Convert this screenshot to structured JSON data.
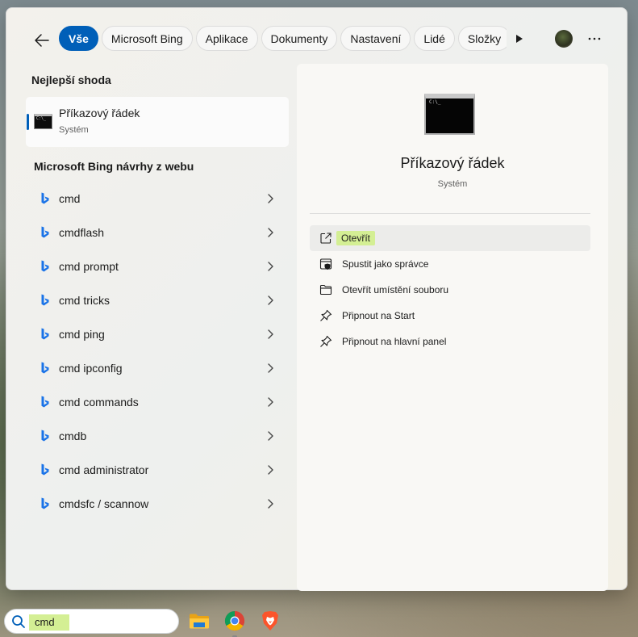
{
  "tabs": [
    {
      "label": "Vše",
      "active": true
    },
    {
      "label": "Microsoft Bing",
      "active": false
    },
    {
      "label": "Aplikace",
      "active": false
    },
    {
      "label": "Dokumenty",
      "active": false
    },
    {
      "label": "Nastavení",
      "active": false
    },
    {
      "label": "Lidé",
      "active": false
    },
    {
      "label": "Složky",
      "active": false
    }
  ],
  "left": {
    "best_match_heading": "Nejlepší shoda",
    "best_match": {
      "title": "Příkazový řádek",
      "subtitle": "Systém",
      "icon": "command-prompt-icon"
    },
    "web_heading": "Microsoft Bing návrhy z webu",
    "suggestions": [
      "cmd",
      "cmdflash",
      "cmd prompt",
      "cmd tricks",
      "cmd ping",
      "cmd ipconfig",
      "cmd commands",
      "cmdb",
      "cmd administrator",
      "cmdsfc / scannow"
    ]
  },
  "detail": {
    "title": "Příkazový řádek",
    "subtitle": "Systém",
    "actions": [
      {
        "label": "Otevřít",
        "icon": "open-external-icon"
      },
      {
        "label": "Spustit jako správce",
        "icon": "shield-admin-icon"
      },
      {
        "label": "Otevřít umístění souboru",
        "icon": "folder-icon"
      },
      {
        "label": "Připnout na Start",
        "icon": "pin-icon"
      },
      {
        "label": "Připnout na hlavní panel",
        "icon": "pin-icon"
      }
    ]
  },
  "taskbar": {
    "search_value": "cmd",
    "apps": [
      "file-explorer-icon",
      "chrome-icon",
      "brave-icon"
    ]
  },
  "colors": {
    "accent": "#005fb8",
    "highlight": "#d4ef94"
  }
}
